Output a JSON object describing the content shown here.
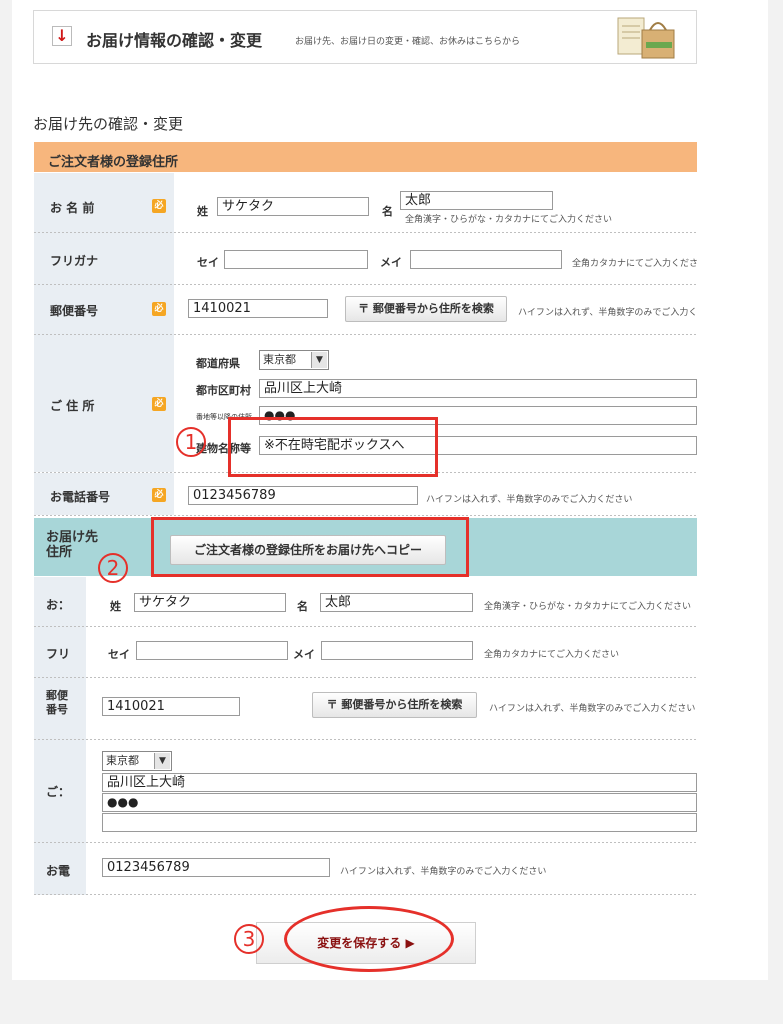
{
  "banner": {
    "title": "お届け情報の確認・変更",
    "subtitle": "お届け先、お届け日の変更・確認、お休みはこちらから"
  },
  "section_title": "お届け先の確認・変更",
  "orderer": {
    "band": "ご注文者様の登録住所",
    "name": {
      "label": "お 名 前",
      "sei_label": "姓",
      "sei": "サケタク",
      "mei_label": "名",
      "mei": "太郎",
      "hint": "全角漢字・ひらがな・カタカナにてご入力ください"
    },
    "kana": {
      "label": "フリガナ",
      "sei_label": "セイ",
      "sei": "",
      "mei_label": "メイ",
      "mei": "",
      "hint": "全角カタカナにてご入力ください"
    },
    "zip": {
      "label": "郵便番号",
      "value": "1410021",
      "search_button": "〒 郵便番号から住所を検索",
      "hint": "ハイフンは入れず、半角数字のみでご入力くだ"
    },
    "address": {
      "label": "ご 住 所",
      "pref_label": "都道府県",
      "pref": "東京都",
      "city_label": "都市区町村",
      "city": "品川区上大崎",
      "street_label": "番地等以降の住所",
      "street": "●●●",
      "building_label": "建物名称等",
      "building": "※不在時宅配ボックスへ"
    },
    "phone": {
      "label": "お電話番号",
      "value": "0123456789",
      "hint": "ハイフンは入れず、半角数字のみでご入力ください"
    }
  },
  "delivery": {
    "band": "お届け先住所",
    "copy_button": "ご注文者様の登録住所をお届け先へコピー",
    "name": {
      "label": "お：",
      "sei_label": "姓",
      "sei": "サケタク",
      "mei_label": "名",
      "mei": "太郎",
      "hint": "全角漢字・ひらがな・カタカナにてご入力ください"
    },
    "kana": {
      "label": "フリ",
      "sei_label": "セイ",
      "sei": "",
      "mei_label": "メイ",
      "mei": "",
      "hint": "全角カタカナにてご入力ください"
    },
    "zip": {
      "label": "郵便番号",
      "value": "1410021",
      "search_button": "〒 郵便番号から住所を検索",
      "hint": "ハイフンは入れず、半角数字のみでご入力ください"
    },
    "address": {
      "label": "ご：",
      "pref": "東京都",
      "city": "品川区上大崎",
      "street": "●●●",
      "building": ""
    },
    "phone": {
      "label": "お電",
      "value": "0123456789",
      "hint": "ハイフンは入れず、半角数字のみでご入力ください"
    }
  },
  "save_button": "変更を保存する ▶",
  "annotations": {
    "one": "1",
    "two": "2",
    "three": "3"
  },
  "colors": {
    "accent_red": "#e5302a",
    "band_orange": "#f7b67d",
    "band_teal": "#a8d6d8",
    "required_badge": "#f5a623"
  }
}
